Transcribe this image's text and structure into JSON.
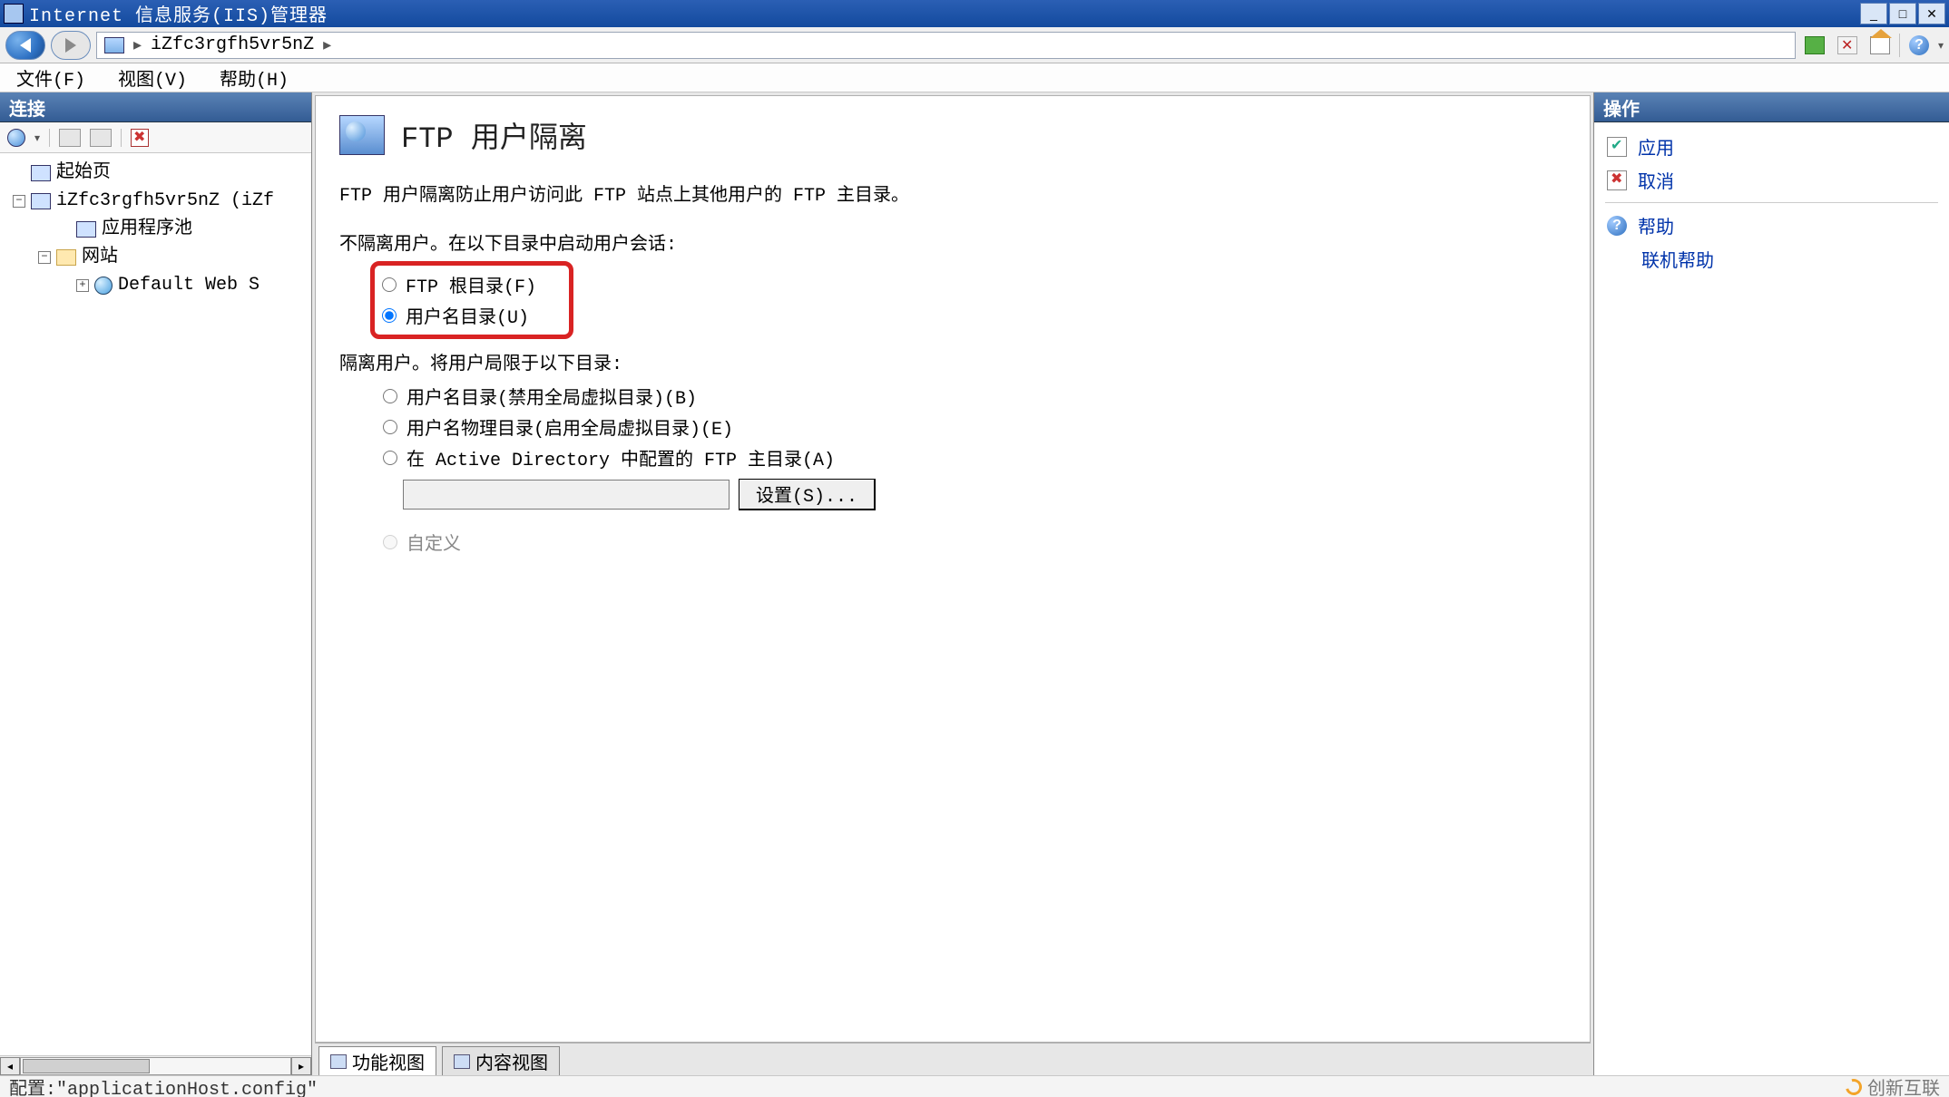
{
  "window": {
    "title": "Internet 信息服务(IIS)管理器"
  },
  "breadcrumb": {
    "server": "iZfc3rgfh5vr5nZ"
  },
  "menu": {
    "file": "文件(F)",
    "view": "视图(V)",
    "help": "帮助(H)"
  },
  "left": {
    "header": "连接",
    "nodes": {
      "start": "起始页",
      "server": "iZfc3rgfh5vr5nZ (iZf",
      "app_pools": "应用程序池",
      "sites": "网站",
      "default_site": "Default Web S"
    }
  },
  "content": {
    "title": "FTP 用户隔离",
    "description": "FTP 用户隔离防止用户访问此 FTP 站点上其他用户的 FTP 主目录。",
    "section1": "不隔离用户。在以下目录中启动用户会话:",
    "opt_root": "FTP 根目录(F)",
    "opt_username": "用户名目录(U)",
    "section2": "隔离用户。将用户局限于以下目录:",
    "opt_user_disable_global": "用户名目录(禁用全局虚拟目录)(B)",
    "opt_user_physical": "用户名物理目录(启用全局虚拟目录)(E)",
    "opt_ad": "在 Active Directory 中配置的 FTP 主目录(A)",
    "ad_set_btn": "设置(S)...",
    "opt_custom": "自定义"
  },
  "tabs": {
    "features": "功能视图",
    "content": "内容视图"
  },
  "actions": {
    "header": "操作",
    "apply": "应用",
    "cancel": "取消",
    "help": "帮助",
    "online_help": "联机帮助"
  },
  "status": {
    "left": "配置:\"applicationHost.config\"",
    "brand": "创新互联"
  }
}
